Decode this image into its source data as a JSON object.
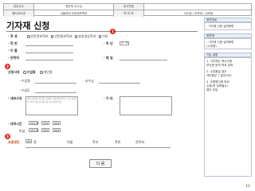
{
  "header": {
    "owner_label": "담당교수",
    "owner_value": "정문제 교수님",
    "doc_label": "문서번호",
    "doc_value": "",
    "app_label": "웹사이트명",
    "app_value": "서울여대 인문정보학부",
    "student_id_label": "학 번 외",
    "student_id_value": "이수명 / 이루재 / 김미랑"
  },
  "page_title": "기자재 신청",
  "form": {
    "dept_label": "· 학  과",
    "dept_options": [
      "인문정보학부",
      "인문통보학과",
      "방송영상학과",
      "기타"
    ],
    "student_no_label": "· 학  번",
    "grade_label": "· 학  년",
    "grade_value": "1",
    "name_label": "· 이  름",
    "phone_label": "· 연락처",
    "email_label": "· 메  일",
    "usage_label": "신청사유",
    "usage_options": [
      "수업용",
      "개인용"
    ],
    "course_label": "- 수업명",
    "professor_label": "- 교수님",
    "class_label": "- 수업도",
    "reason_label": "· 세부사유",
    "reason_placeholder": "세부사유를 최대한 상세히 입력해주세요. 사진 촬영의 경우 장소와 용도를 명시해주세요.",
    "etc_label": "· 기  타",
    "rental_label": "· 대여시간",
    "rental_year": "2013",
    "rental_month_1": "03",
    "rental_day_1": "00",
    "return_label": "반납",
    "return_year": "2013",
    "return_month": "03",
    "return_day": "00",
    "coapplicant_label": "조원명단",
    "coapplicant_count": "0",
    "coapplicant_unit": "명",
    "col_name": "이름",
    "col_dept": "학과",
    "col_id": "학번",
    "col_phone": "연락처",
    "submit_label": "다 음"
  },
  "badges": [
    "1",
    "2",
    "3"
  ],
  "right_panel": {
    "section1_title": "화면경로",
    "section1_text": "- 기자재 신청 입력화면",
    "section2_title": "화면명",
    "section2_text": "- 기자재 신청 입력화면\n(수업용)",
    "section3_title": "기능 설명",
    "items": [
      "1. 기자재는 복수인증\n   부인증 등의 학과 입력",
      "2. 수업용일 경우\n   개인용은 7 일간이다.",
      "3. 조원명단에 따라\n   수록(최 입력필수)\n   명이 조입"
    ]
  },
  "page_number": "12"
}
